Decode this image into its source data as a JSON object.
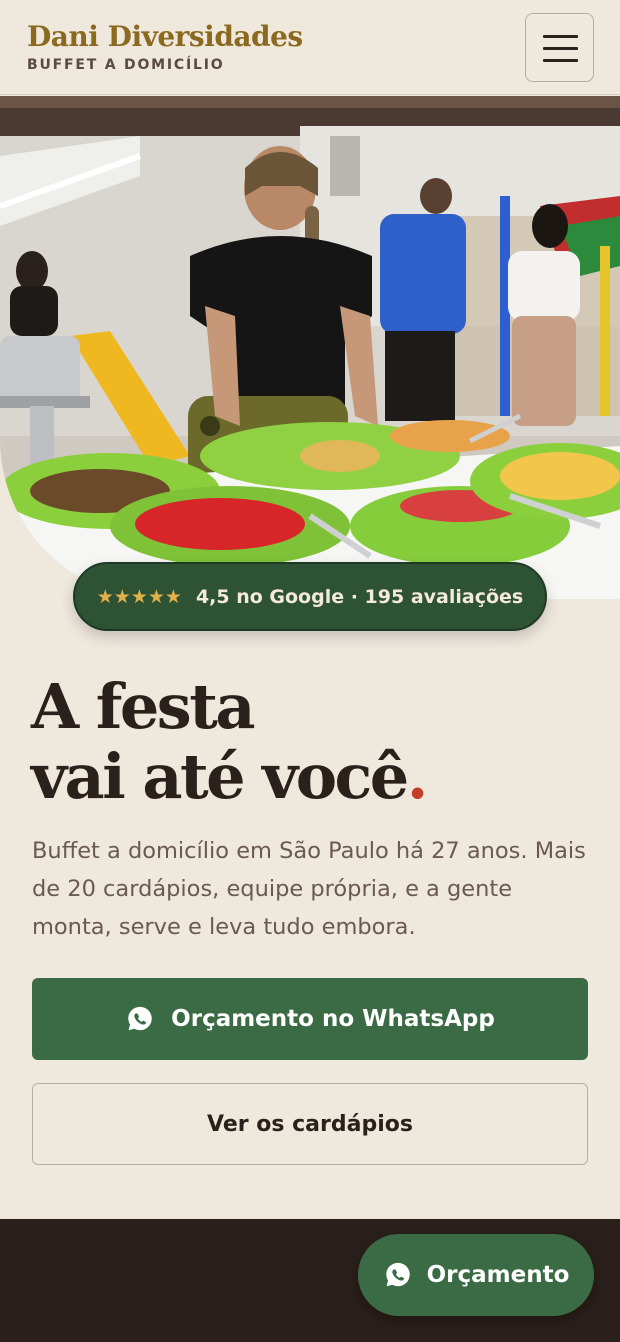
{
  "brand": {
    "name": "Dani Diversidades",
    "tagline": "BUFFET A DOMICÍLIO"
  },
  "icons": {
    "menu": "hamburger-menu-icon",
    "whatsapp": "whatsapp-icon",
    "stars": "star-icon"
  },
  "hero": {
    "rating_stars": "★★★★★",
    "rating_text": "4,5 no Google · 195 avaliações"
  },
  "headline": {
    "line1": "A festa",
    "line2": "vai até você",
    "dot": "."
  },
  "lead": "Buffet a domicílio em São Paulo há 27 anos. Mais de 20 cardápios, equipe própria, e a gente monta, serve e leva tudo embora.",
  "cta": {
    "whatsapp_label": "Orçamento no WhatsApp",
    "menus_label": "Ver os cardápios"
  },
  "fab": {
    "label": "Orçamento"
  },
  "colors": {
    "background": "#efe8dd",
    "brand": "#8b6a1f",
    "green": "#3a6b44",
    "badge": "#2e5234",
    "accent_dot": "#c43d28",
    "dark": "#2a1f1a"
  }
}
